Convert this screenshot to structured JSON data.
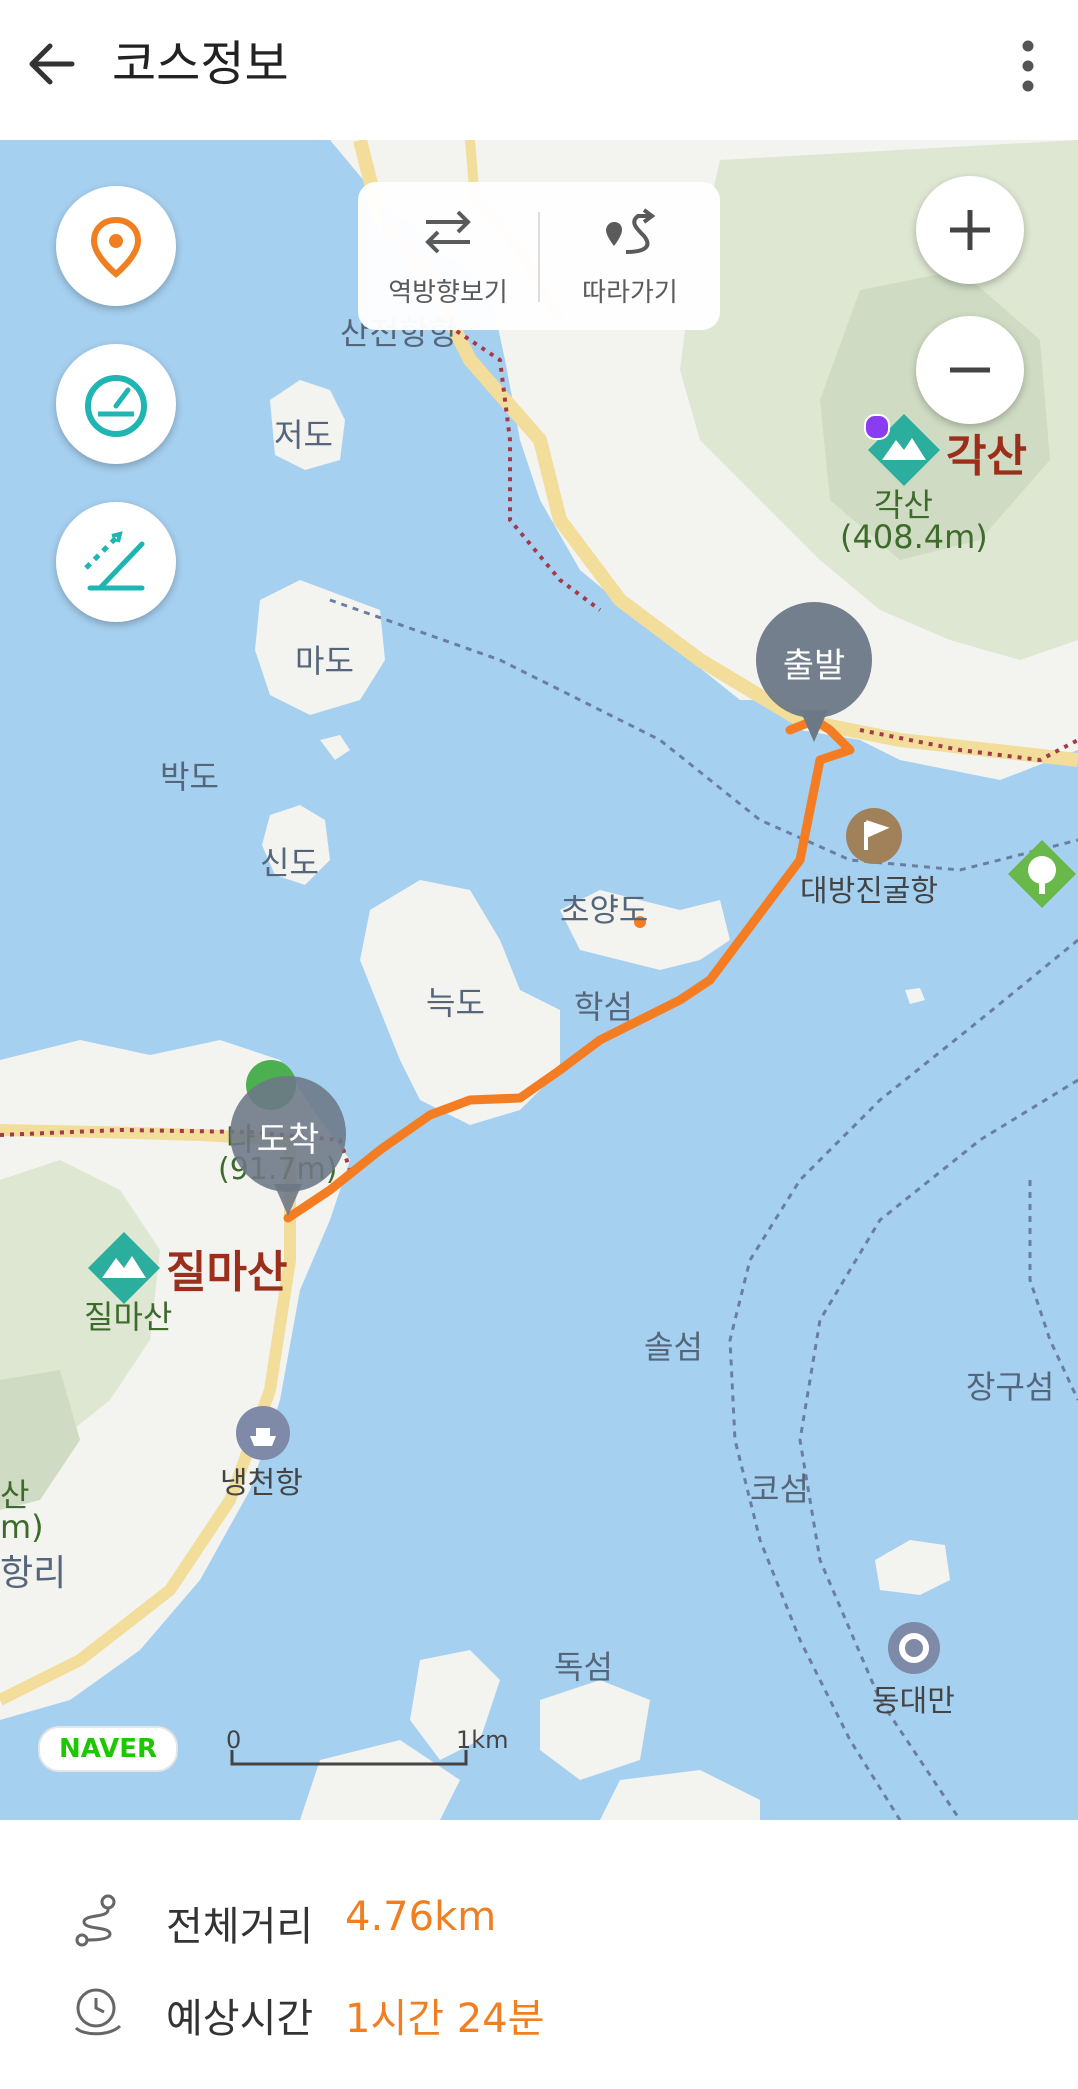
{
  "header": {
    "title": "코스정보",
    "back_icon": "back-arrow-icon",
    "more_icon": "more-vertical-icon"
  },
  "map": {
    "tools": {
      "reverse_label": "역방향보기",
      "follow_label": "따라가기"
    },
    "left_buttons": [
      "location-pin-icon",
      "speedometer-icon",
      "altitude-icon"
    ],
    "zoom": {
      "in": "+",
      "out": "−"
    },
    "pins": {
      "start": "출발",
      "end": "도착"
    },
    "labels": {
      "jeodo": "저도",
      "mado": "마도",
      "bakdo": "박도",
      "sindo": "신도",
      "choyangdo": "초양도",
      "neukdo": "늑도",
      "hakseom": "학섬",
      "solseom": "솔섬",
      "koseom": "코섬",
      "dokseom": "독섬",
      "janggu": "장구섬",
      "daebang": "대방진굴항",
      "naengcheon": "냉천항",
      "dongdaeman": "동대만",
      "gaksan_big": "각산",
      "gaksan_small": "각산",
      "gaksan_elev": "(408.4m)",
      "jilma_big": "질마산",
      "jilma_small": "질마산",
      "na_peak": "나",
      "na_elev": "(91.7m)",
      "left_san": "산",
      "left_m": "m)",
      "left_ri": "항리",
      "partial_top": "산전항항"
    },
    "brand": "NAVER",
    "scale": {
      "start": "0",
      "end": "1km"
    }
  },
  "info": {
    "distance_label": "전체거리",
    "distance_value": "4.76km",
    "time_label": "예상시간",
    "time_value": "1시간 24분"
  },
  "colors": {
    "sea": "#a6d0f0",
    "land": "#f4f4f1",
    "route": "#f47d23",
    "accent": "#f07f22",
    "pin": "#6c7886"
  }
}
